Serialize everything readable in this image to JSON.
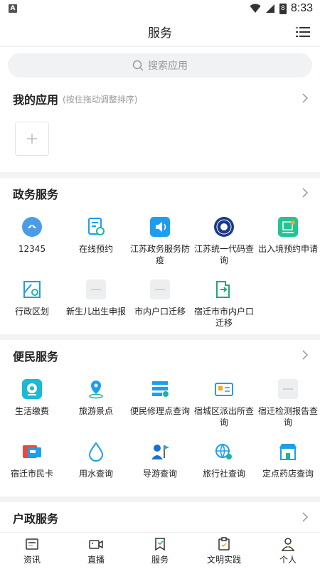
{
  "status_bar": {
    "badge": "A",
    "time": "8:33",
    "battery_level": "8"
  },
  "header": {
    "title": "服务"
  },
  "search": {
    "placeholder": "搜索应用"
  },
  "my_apps": {
    "title": "我的应用",
    "subtitle": "(按住拖动调整排序)"
  },
  "gov_services": {
    "title": "政务服务",
    "items": [
      {
        "label": "12345",
        "icon": "hotline-icon"
      },
      {
        "label": "在线预约",
        "icon": "appointment-icon"
      },
      {
        "label": "江苏政务服务防疫",
        "icon": "announcement-icon"
      },
      {
        "label": "江苏统一代码查询",
        "icon": "seal-icon"
      },
      {
        "label": "出入境预约申请",
        "icon": "exit-entry-icon"
      },
      {
        "label": "行政区划",
        "icon": "map-region-icon"
      },
      {
        "label": "新生儿出生申报",
        "icon": "placeholder-icon"
      },
      {
        "label": "市内户口迁移",
        "icon": "placeholder-icon"
      },
      {
        "label": "宿迁市市内户口迁移",
        "icon": "transfer-icon"
      }
    ]
  },
  "convenience_services": {
    "title": "便民服务",
    "items": [
      {
        "label": "生活缴费",
        "icon": "payment-icon"
      },
      {
        "label": "旅游景点",
        "icon": "location-pin-icon"
      },
      {
        "label": "便民修理点查询",
        "icon": "repair-icon"
      },
      {
        "label": "宿城区派出所查询",
        "icon": "id-card-icon"
      },
      {
        "label": "宿迁检测报告查询",
        "icon": "placeholder-icon"
      },
      {
        "label": "宿迁市民卡",
        "icon": "citizen-card-icon"
      },
      {
        "label": "用水查询",
        "icon": "water-drop-icon"
      },
      {
        "label": "导游查询",
        "icon": "guide-icon"
      },
      {
        "label": "旅行社查询",
        "icon": "travel-agency-icon"
      },
      {
        "label": "定点药店查询",
        "icon": "pharmacy-icon"
      }
    ]
  },
  "household_services": {
    "title": "户政服务"
  },
  "bottom_nav": [
    {
      "label": "资讯",
      "icon": "news-icon"
    },
    {
      "label": "直播",
      "icon": "live-icon"
    },
    {
      "label": "服务",
      "icon": "service-icon"
    },
    {
      "label": "文明实践",
      "icon": "civic-icon"
    },
    {
      "label": "个人",
      "icon": "profile-icon"
    }
  ],
  "colors": {
    "accent": "#1b9ef0",
    "teal": "#22b49a",
    "orange": "#f5a623",
    "red": "#e84b3c"
  }
}
